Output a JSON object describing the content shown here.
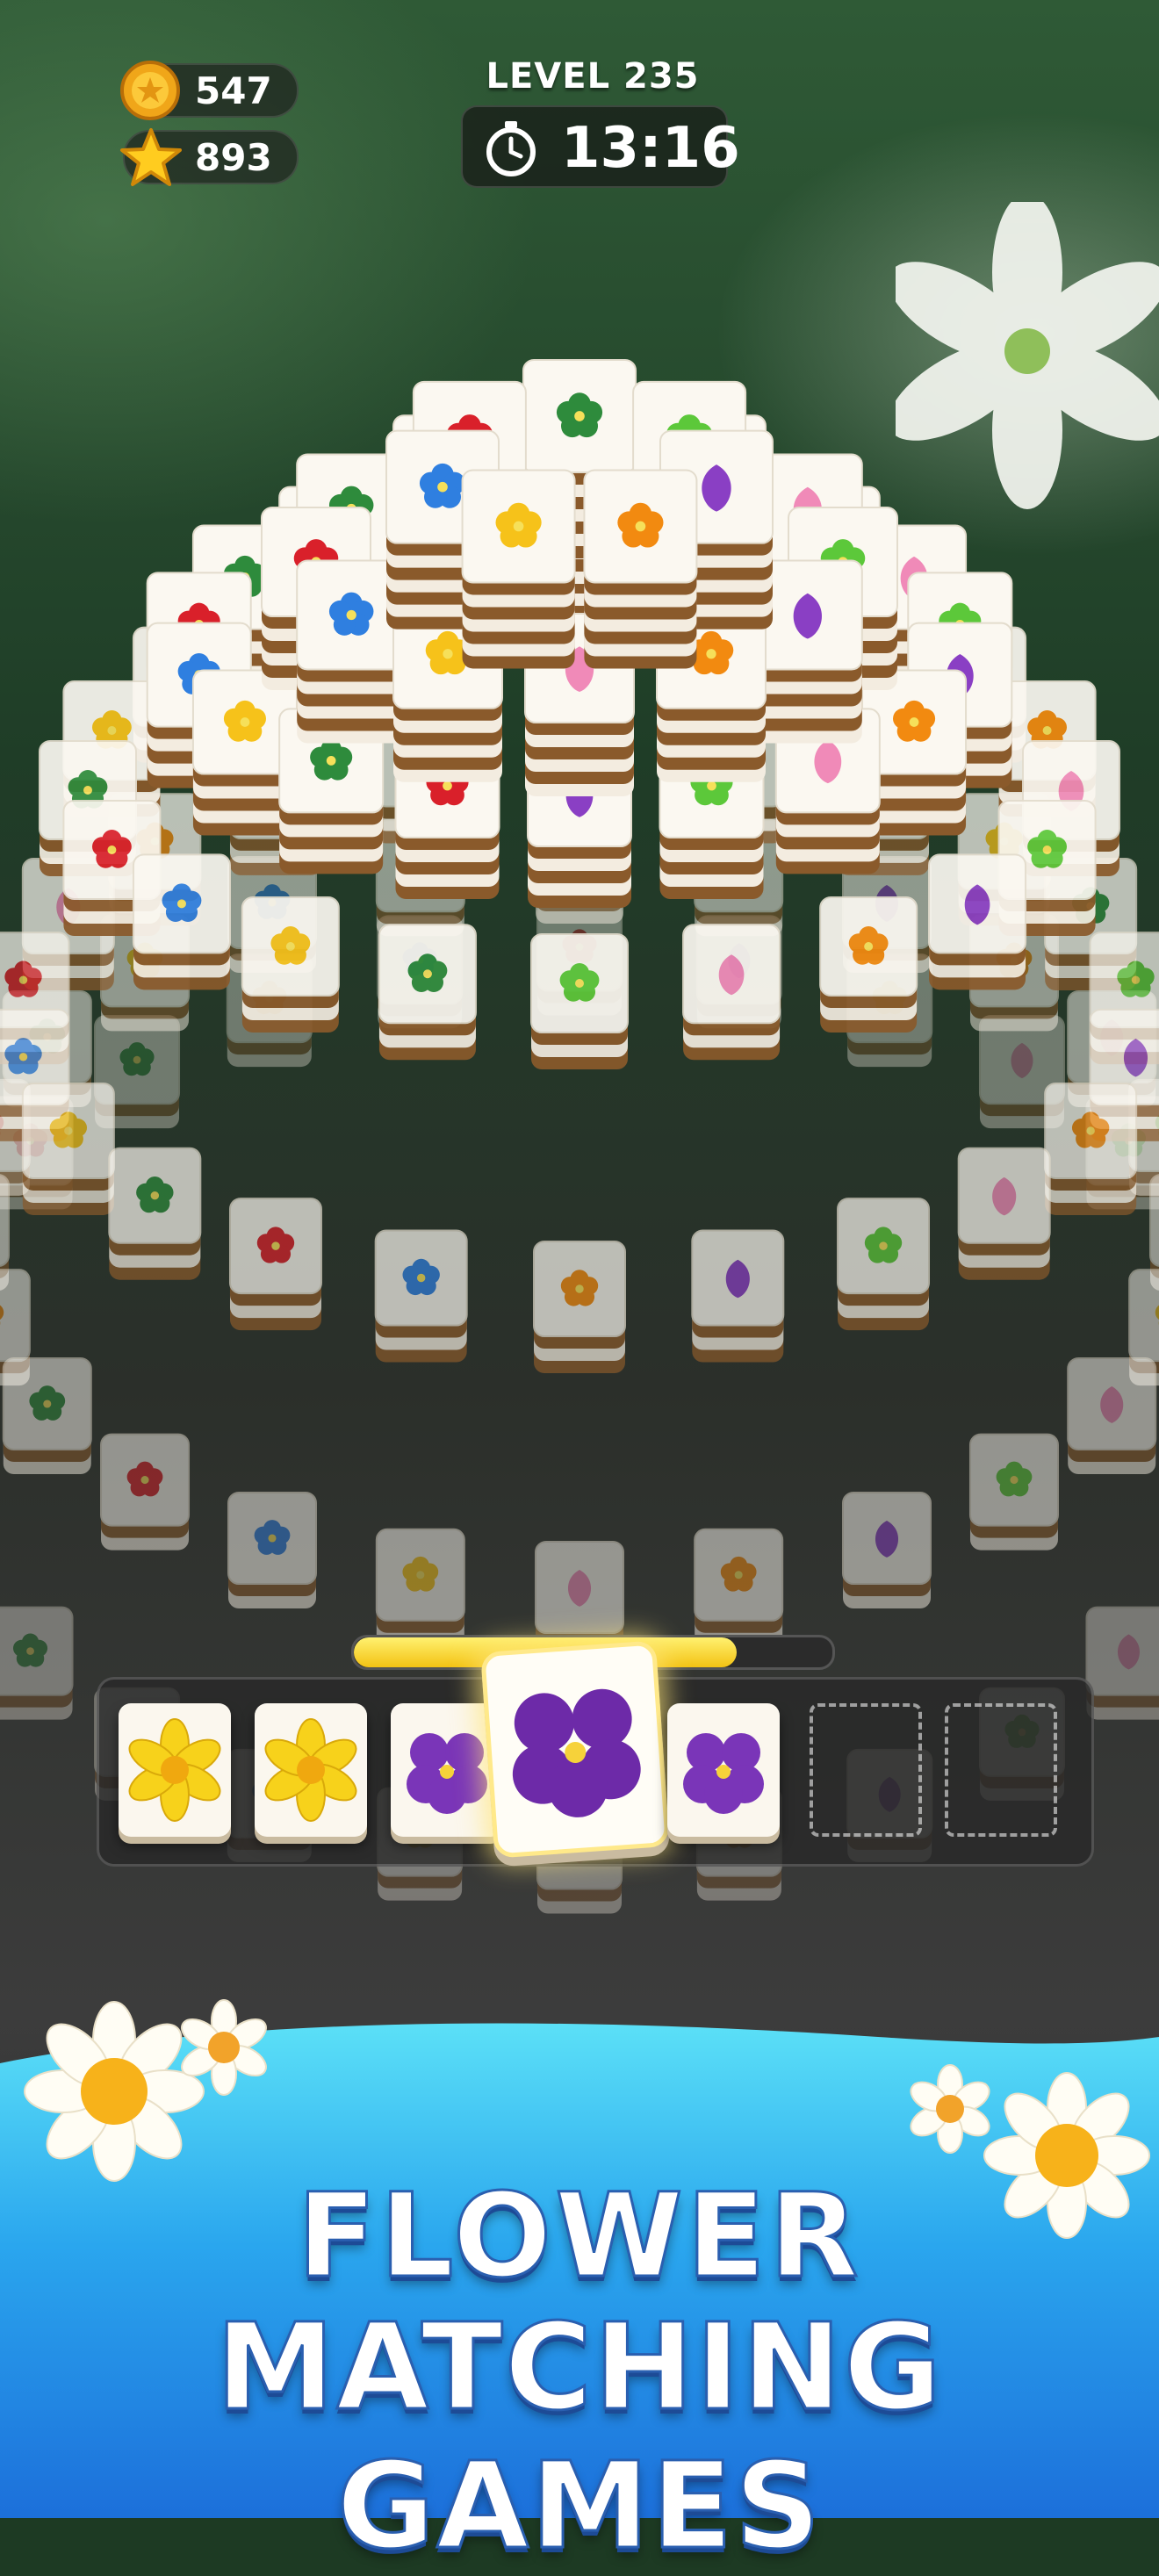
{
  "hud": {
    "coins": "547",
    "stars": "893",
    "level_label": "LEVEL 235",
    "timer": "13:16",
    "coin_icon": "coin-icon",
    "star_icon": "star-icon",
    "stopwatch_icon": "stopwatch-icon"
  },
  "tray": {
    "progress_fraction": 0.8,
    "slots": [
      {
        "flower": "daffodil",
        "state": "filled"
      },
      {
        "flower": "daffodil",
        "state": "filled"
      },
      {
        "flower": "violet",
        "state": "filled"
      },
      {
        "flower": "violet",
        "state": "selected"
      },
      {
        "flower": "violet",
        "state": "filled"
      },
      {
        "flower": "",
        "state": "empty"
      },
      {
        "flower": "",
        "state": "empty"
      }
    ]
  },
  "banner": {
    "line1": "FLOWER",
    "line2": "MATCHING GAMES"
  },
  "colors": {
    "red": "#d9202a",
    "purple": "#8a3fc4",
    "blue": "#2f7fe0",
    "orange": "#f28a10",
    "yellow": "#f6c21a",
    "pink": "#f08ab8",
    "green": "#2e8b3c",
    "lime": "#5cc83a",
    "banner_top": "#4ad6f5",
    "banner_bottom": "#1f7fe0"
  }
}
